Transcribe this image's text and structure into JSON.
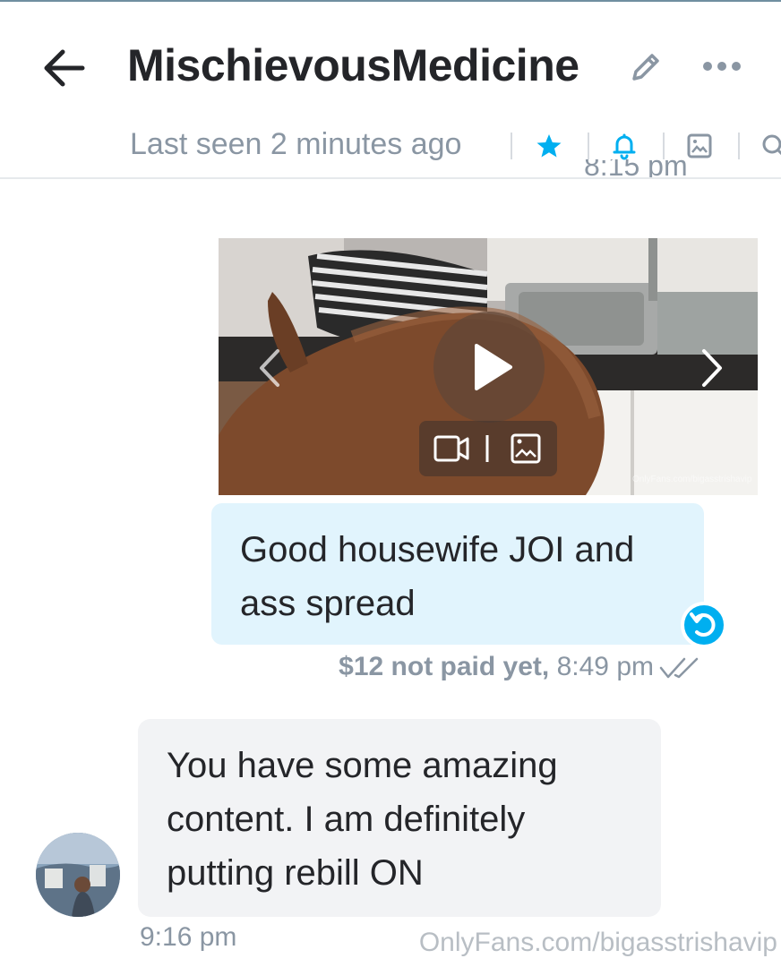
{
  "header": {
    "title": "MischievousMedicine",
    "last_seen": "Last seen 2 minutes ago",
    "icons": [
      "back-arrow-icon",
      "pencil-icon",
      "more-dots-icon",
      "star-icon",
      "bell-icon",
      "image-icon",
      "search-icon"
    ],
    "accent_color": "#00aff0"
  },
  "previous_message": {
    "time": "8:15 pm"
  },
  "media_message": {
    "watermark": "OnlyFans.com/bigasstrishavip",
    "media_type_icons": [
      "video-camera-icon",
      "image-icon"
    ]
  },
  "sent_message": {
    "text": "Good housewife JOI and ass spread",
    "price": "$12 not paid yet,",
    "time": "8:49 pm",
    "bubble_color": "#e1f4fd"
  },
  "received_message": {
    "text": "You have some amazing content. I am definitely putting rebill ON",
    "time": "9:16 pm",
    "bubble_color": "#f2f3f5"
  },
  "footer_watermark": "OnlyFans.com/bigasstrishavip"
}
